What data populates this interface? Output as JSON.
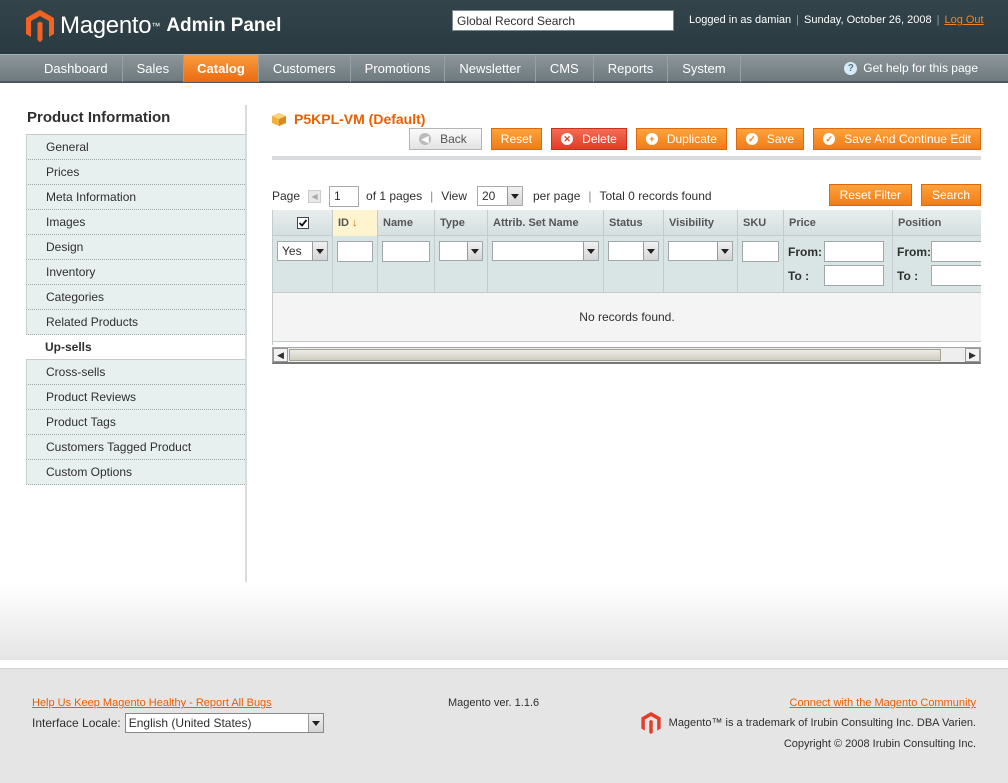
{
  "header": {
    "app_name": "Magento",
    "app_sub": "Admin Panel",
    "search_value": "Global Record Search",
    "logged_in": "Logged in as damian",
    "date": "Sunday, October 26, 2008",
    "logout": "Log Out"
  },
  "nav": {
    "items": [
      "Dashboard",
      "Sales",
      "Catalog",
      "Customers",
      "Promotions",
      "Newsletter",
      "CMS",
      "Reports",
      "System"
    ],
    "active": "Catalog",
    "help": "Get help for this page"
  },
  "sidebar": {
    "title": "Product Information",
    "items": [
      "General",
      "Prices",
      "Meta Information",
      "Images",
      "Design",
      "Inventory",
      "Categories",
      "Related Products",
      "Up-sells",
      "Cross-sells",
      "Product Reviews",
      "Product Tags",
      "Customers Tagged Product",
      "Custom Options"
    ],
    "active": "Up-sells"
  },
  "product": {
    "title": "P5KPL-VM (Default)"
  },
  "buttons": {
    "back": "Back",
    "reset": "Reset",
    "delete": "Delete",
    "duplicate": "Duplicate",
    "save": "Save",
    "save_continue": "Save And Continue Edit"
  },
  "pager": {
    "page_label": "Page",
    "page_value": "1",
    "of_pages": "of 1 pages",
    "view_label": "View",
    "view_value": "20",
    "per_page": "per page",
    "total": "Total 0 records found",
    "reset_filter": "Reset Filter",
    "search": "Search"
  },
  "grid": {
    "columns": [
      "ID",
      "Name",
      "Type",
      "Attrib. Set Name",
      "Status",
      "Visibility",
      "SKU",
      "Price",
      "Position"
    ],
    "filter_select": "Yes",
    "from_label": "From:",
    "to_label": "To :",
    "empty": "No records found."
  },
  "footer": {
    "bugs_link": "Help Us Keep Magento Healthy - Report All Bugs",
    "locale_label": "Interface Locale:",
    "locale_value": "English (United States)",
    "version": "Magento ver. 1.1.6",
    "community_link": "Connect with the Magento Community",
    "trademark": "Magento™ is a trademark of Irubin Consulting Inc. DBA Varien.",
    "copyright": "Copyright © 2008 Irubin Consulting Inc."
  },
  "colors": {
    "accent": "#eb5e00",
    "header_bg": "#2f4047",
    "nav_bg": "#7d878c"
  }
}
